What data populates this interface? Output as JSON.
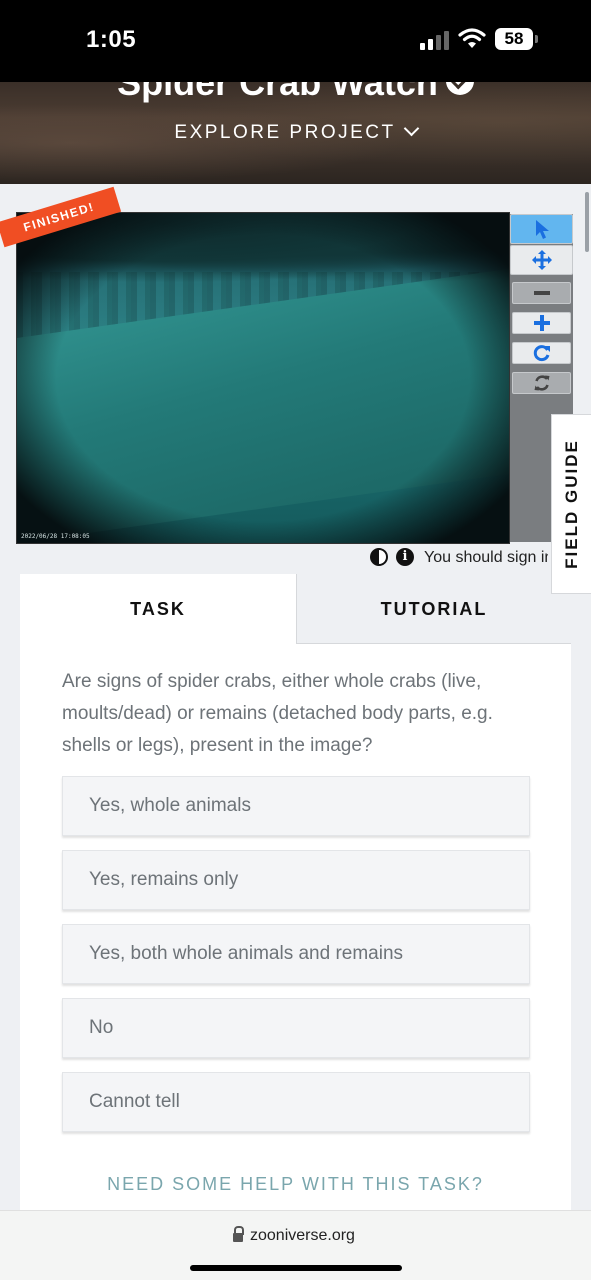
{
  "status_bar": {
    "time": "1:05",
    "battery": "58",
    "icons": [
      "signal-icon",
      "wifi-icon",
      "battery-icon"
    ]
  },
  "header": {
    "project_title": "Spider Crab Watch",
    "explore_label": "EXPLORE PROJECT"
  },
  "subject": {
    "ribbon": "FINISHED!",
    "timestamp": "2022/06/28 17:08:05",
    "toolbar": [
      "pointer-icon",
      "move-icon",
      "zoom-out-icon",
      "zoom-in-icon",
      "rotate-icon",
      "reset-icon"
    ],
    "sign_in_note": "You should sign in"
  },
  "field_guide": {
    "label": "FIELD GUIDE"
  },
  "task_panel": {
    "tabs": [
      {
        "label": "TASK",
        "active": true
      },
      {
        "label": "TUTORIAL",
        "active": false
      }
    ],
    "question": "Are signs of spider crabs, either whole crabs (live, moults/dead) or remains (detached body parts, e.g. shells or legs), present in the image?",
    "answers": [
      "Yes, whole animals",
      "Yes, remains only",
      "Yes, both whole animals and remains",
      "No",
      "Cannot tell"
    ],
    "help_link": "NEED SOME HELP WITH THIS TASK?"
  },
  "browser": {
    "url": "zooniverse.org"
  },
  "colors": {
    "ribbon": "#f04e23",
    "active_tool": "#62b6ef",
    "tool_icon": "#1a6fe0",
    "help_link": "#7aa6ad"
  }
}
